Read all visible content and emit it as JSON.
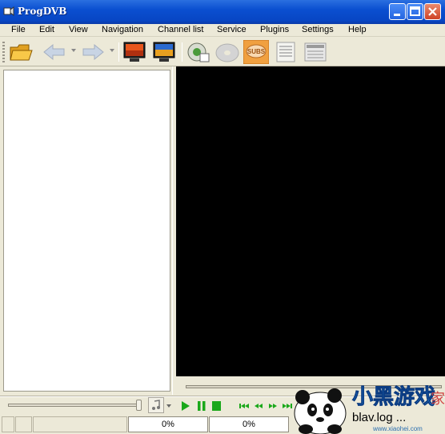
{
  "window": {
    "title": "ProgDVB"
  },
  "menu": [
    "File",
    "Edit",
    "View",
    "Navigation",
    "Channel list",
    "Service",
    "Plugins",
    "Settings",
    "Help"
  ],
  "toolbar": {
    "icons": [
      "open-folder-icon",
      "back-arrow-icon",
      "forward-arrow-icon",
      "tv-monitor-icon",
      "tv-monitor-2-icon",
      "record-disc-icon",
      "disc-icon",
      "subs-icon",
      "epg-list-icon",
      "teletext-icon"
    ],
    "subs_label": "SUBS"
  },
  "status": {
    "left_percent": "0%",
    "right_percent": "0%"
  },
  "watermark": {
    "text": "小黑游戏",
    "url": "blav.log  ...",
    "site": "www.xiaohei.com",
    "suffix": "家"
  },
  "colors": {
    "titlebar": "#0a4fd0",
    "video": "#000000",
    "accent_green": "#1aa81a",
    "subs_orange": "#f0a040"
  }
}
